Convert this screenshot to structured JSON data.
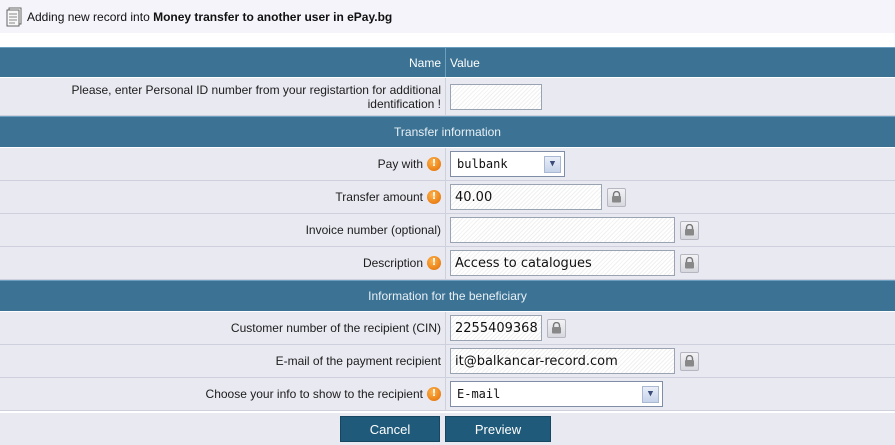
{
  "header": {
    "prefix": "Adding new record into",
    "target": "Money transfer to another user in ePay.bg"
  },
  "table": {
    "col_name": "Name",
    "col_value": "Value"
  },
  "personal_id": {
    "label": "Please, enter Personal ID number from your registartion for additional identification !",
    "value": ""
  },
  "sections": {
    "transfer": "Transfer information",
    "beneficiary": "Information for the beneficiary"
  },
  "fields": {
    "pay_with": {
      "label": "Pay with",
      "value": "bulbank"
    },
    "amount": {
      "label": "Transfer amount",
      "value": "40.00"
    },
    "invoice": {
      "label": "Invoice number (optional)",
      "value": ""
    },
    "description": {
      "label": "Description",
      "value": "Access to catalogues"
    },
    "cin": {
      "label": "Customer number of the recipient (CIN)",
      "value": "2255409368"
    },
    "email": {
      "label": "E-mail of the payment recipient",
      "value": "it@balkancar-record.com"
    },
    "show_info": {
      "label": "Choose your info to show to the recipient",
      "value": "E-mail"
    }
  },
  "required_mark": "!",
  "buttons": {
    "cancel": "Cancel",
    "preview": "Preview"
  },
  "icons": {
    "header": "document-icon",
    "required": "exclamation-icon",
    "lock": "lock-icon",
    "dropdown": "chevron-down-icon"
  },
  "colors": {
    "header_bg": "#3c7293",
    "row_bg": "#e9e9f2",
    "button_bg": "#1f5a7a",
    "required": "#e06a00"
  }
}
